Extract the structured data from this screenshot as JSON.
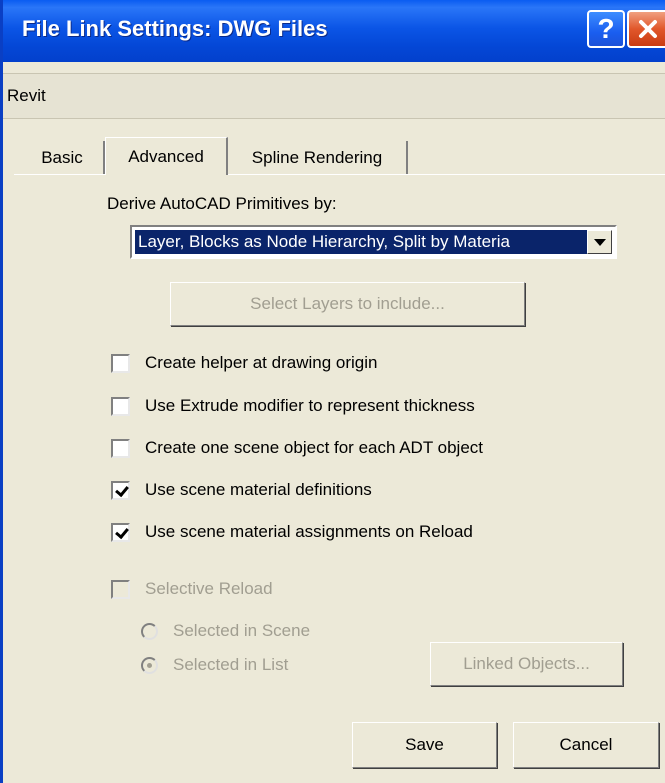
{
  "window": {
    "title": "File Link Settings: DWG Files",
    "help_glyph": "?",
    "close_glyph": "×"
  },
  "header": {
    "text": "Revit"
  },
  "tabs": [
    {
      "label": "Basic"
    },
    {
      "label": "Advanced",
      "active": true
    },
    {
      "label": "Spline Rendering"
    }
  ],
  "advanced": {
    "derive_label": "Derive AutoCAD Primitives by:",
    "derive_value": "Layer, Blocks as Node Hierarchy, Split by Materia",
    "select_layers_label": "Select Layers to include...",
    "options": [
      {
        "label": "Create helper at drawing origin",
        "checked": false
      },
      {
        "label": "Use Extrude modifier to represent thickness",
        "checked": false
      },
      {
        "label": "Create one scene object for each ADT object",
        "checked": false
      },
      {
        "label": "Use scene material definitions",
        "checked": true
      },
      {
        "label": "Use scene material assignments on Reload",
        "checked": true
      }
    ],
    "selective_reload": {
      "label": "Selective Reload",
      "checked": false,
      "enabled": false
    },
    "radios": [
      {
        "label": "Selected in Scene",
        "selected": false
      },
      {
        "label": "Selected in List",
        "selected": true
      }
    ],
    "linked_objects_label": "Linked Objects..."
  },
  "footer": {
    "save_label": "Save",
    "cancel_label": "Cancel"
  },
  "colors": {
    "titlebar": "#0447d6",
    "selection": "#0a246a",
    "dialog_bg": "#ece9d8",
    "disabled_text": "#a19e91"
  }
}
